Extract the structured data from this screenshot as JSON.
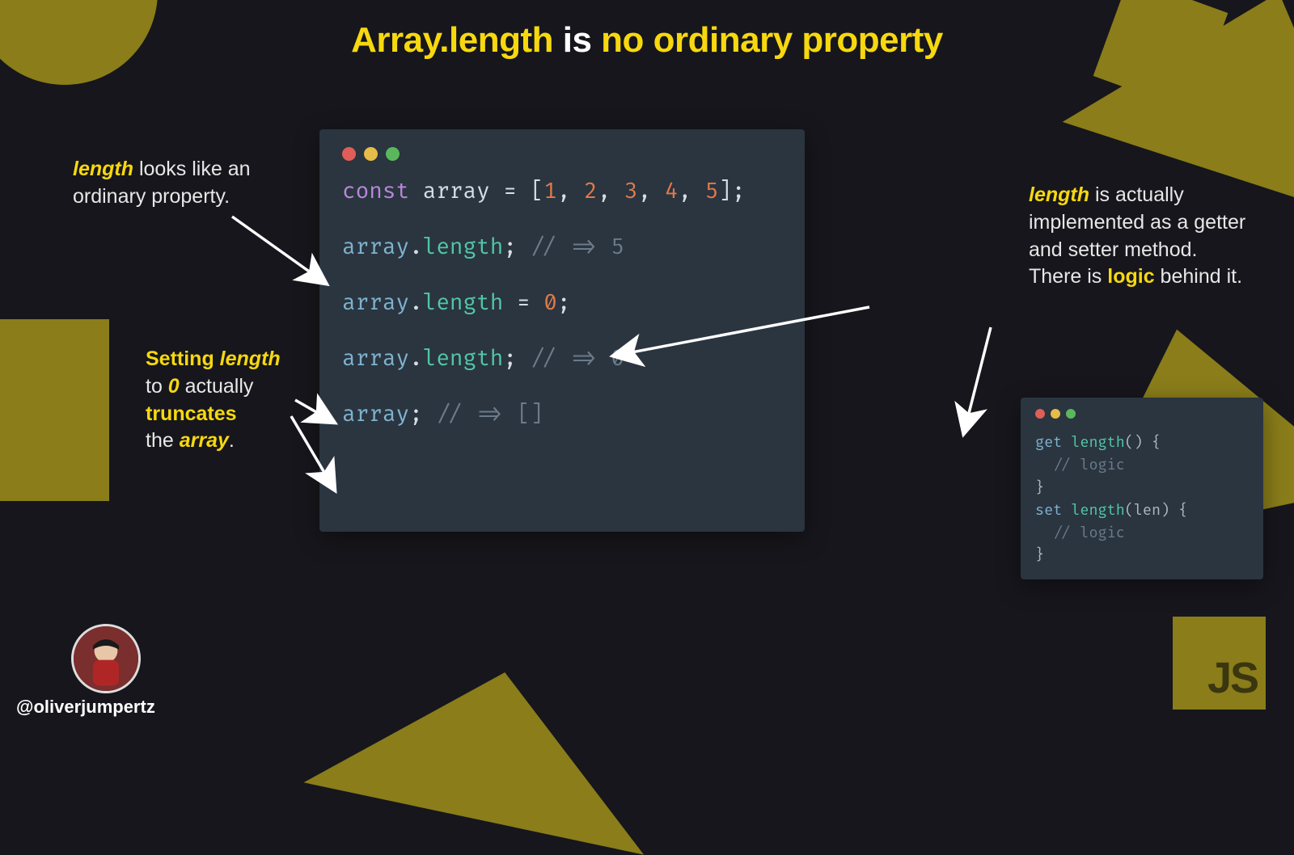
{
  "title": {
    "part1": "Array.length",
    "part2": "is",
    "part3": "no ordinary property"
  },
  "callouts": {
    "c1": {
      "hl": "length",
      "rest": " looks like an ordinary property."
    },
    "c2": {
      "l1a": "Setting ",
      "l1b": "length",
      "l2a": "to ",
      "l2b": "0",
      "l2c": " actually",
      "l3a": "truncates",
      "l4a": "the ",
      "l4b": "array",
      "l4c": "."
    },
    "c3": {
      "hl": "length",
      "rest1": " is actually implemented as a getter and setter method. There is ",
      "hl2": "logic",
      "rest2": " behind it."
    }
  },
  "code_main": {
    "l1": {
      "kw": "const",
      "sp": " ",
      "id": "array",
      "eq": " = [",
      "n1": "1",
      "c": ", ",
      "n2": "2",
      "n3": "3",
      "n4": "4",
      "n5": "5",
      "end": "];"
    },
    "l2": {
      "id": "array",
      "dot": ".",
      "prop": "length",
      "semi": ";",
      "cm": " // => 5"
    },
    "l3": {
      "id": "array",
      "dot": ".",
      "prop": "length",
      "eq": " = ",
      "num": "0",
      "semi": ";"
    },
    "l4": {
      "id": "array",
      "dot": ".",
      "prop": "length",
      "semi": ";",
      "cm": " // => 0"
    },
    "l5": {
      "id": "array",
      "semi": ";",
      "cm": " // => []"
    }
  },
  "code_small": {
    "l1": {
      "kw": "get",
      "sp": " ",
      "fn": "length",
      "paren": "() {"
    },
    "l2": {
      "cm": "  // logic"
    },
    "l3": {
      "br": "}"
    },
    "l4": {
      "kw": "set",
      "sp": " ",
      "fn": "length",
      "paren": "(",
      "arg": "len",
      "paren2": ") {"
    },
    "l5": {
      "cm": "  // logic"
    },
    "l6": {
      "br": "}"
    }
  },
  "js_badge": "JS",
  "author_handle": "@oliverjumpertz"
}
